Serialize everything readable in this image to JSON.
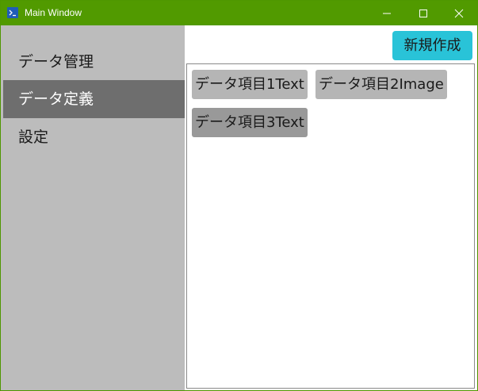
{
  "window": {
    "title": "Main Window"
  },
  "sidebar": {
    "items": [
      {
        "label": "データ管理",
        "selected": false
      },
      {
        "label": "データ定義",
        "selected": true
      },
      {
        "label": "設定",
        "selected": false
      }
    ]
  },
  "main": {
    "create_button_label": "新規作成",
    "items": [
      {
        "label": "データ項目1Text"
      },
      {
        "label": "データ項目2Image"
      },
      {
        "label": "データ項目3Text"
      }
    ]
  },
  "colors": {
    "titlebar": "#519a00",
    "sidebar": "#bcbcbc",
    "sidebar_selected": "#6e6e6e",
    "accent_button": "#29c3d8",
    "chip": "#b5b5b5"
  },
  "icons": {
    "app": "terminal-icon",
    "minimize": "minimize-icon",
    "maximize": "maximize-icon",
    "close": "close-icon"
  }
}
